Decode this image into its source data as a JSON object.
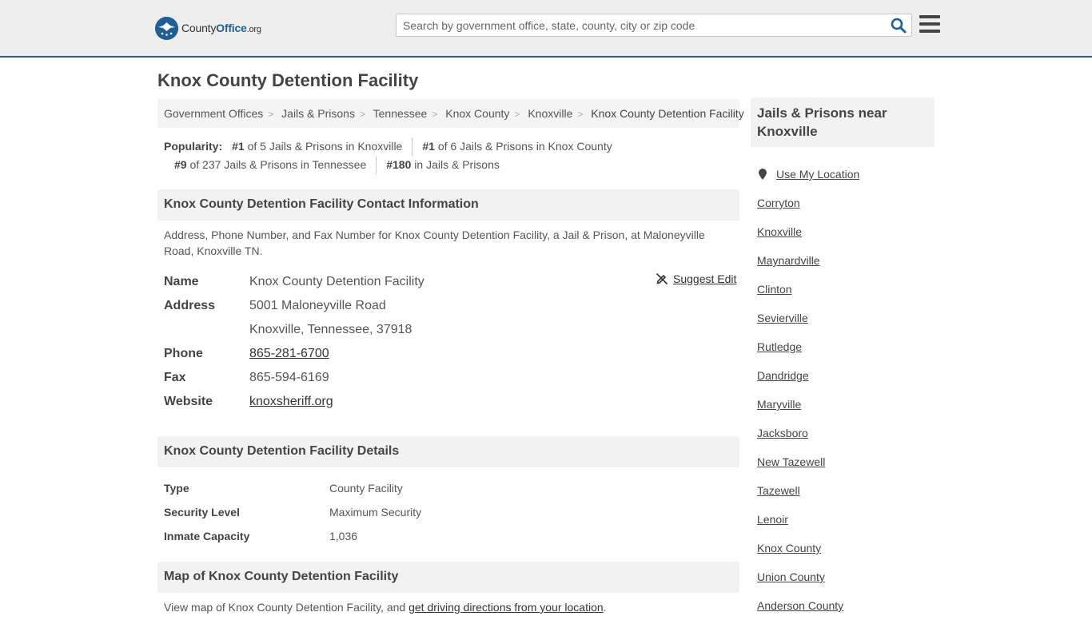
{
  "header": {
    "logo": {
      "name_a": "County",
      "name_b": "Office",
      "name_c": ".org"
    },
    "search_placeholder": "Search by government office, state, county, city or zip code"
  },
  "page_title": "Knox County Detention Facility",
  "breadcrumb": [
    "Government Offices",
    "Jails & Prisons",
    "Tennessee",
    "Knox County",
    "Knoxville",
    "Knox County Detention Facility"
  ],
  "popularity": {
    "label": "Popularity:",
    "items": [
      {
        "rank": "#1",
        "text": "of 5 Jails & Prisons in Knoxville"
      },
      {
        "rank": "#1",
        "text": "of 6 Jails & Prisons in Knox County"
      },
      {
        "rank": "#9",
        "text": "of 237 Jails & Prisons in Tennessee"
      },
      {
        "rank": "#180",
        "text": "in Jails & Prisons"
      }
    ]
  },
  "contact": {
    "heading": "Knox County Detention Facility Contact Information",
    "description": "Address, Phone Number, and Fax Number for Knox County Detention Facility, a Jail & Prison, at Maloneyville Road, Knoxville TN.",
    "suggest_edit": "Suggest Edit",
    "name_label": "Name",
    "name": "Knox County Detention Facility",
    "address_label": "Address",
    "address_1": "5001 Maloneyville Road",
    "address_2": "Knoxville, Tennessee, 37918",
    "phone_label": "Phone",
    "phone": "865-281-6700",
    "fax_label": "Fax",
    "fax": "865-594-6169",
    "website_label": "Website",
    "website": "knoxsheriff.org"
  },
  "details": {
    "heading": "Knox County Detention Facility Details",
    "rows": [
      {
        "label": "Type",
        "value": "County Facility"
      },
      {
        "label": "Security Level",
        "value": "Maximum Security"
      },
      {
        "label": "Inmate Capacity",
        "value": "1,036"
      }
    ]
  },
  "map": {
    "heading": "Map of Knox County Detention Facility",
    "desc_prefix": "View map of Knox County Detention Facility, and ",
    "desc_link": "get driving directions from your location",
    "desc_suffix": "."
  },
  "sidebar": {
    "heading": "Jails & Prisons near Knoxville",
    "use_location": "Use My Location",
    "items": [
      "Corryton",
      "Knoxville",
      "Maynardville",
      "Clinton",
      "Sevierville",
      "Rutledge",
      "Dandridge",
      "Maryville",
      "Jacksboro",
      "New Tazewell",
      "Tazewell",
      "Lenoir",
      "Knox County",
      "Union County",
      "Anderson County"
    ]
  },
  "colors": {
    "brand": "#1f5f95",
    "header_bg": "#eeeeee",
    "section_bg": "#f2f2f2"
  }
}
